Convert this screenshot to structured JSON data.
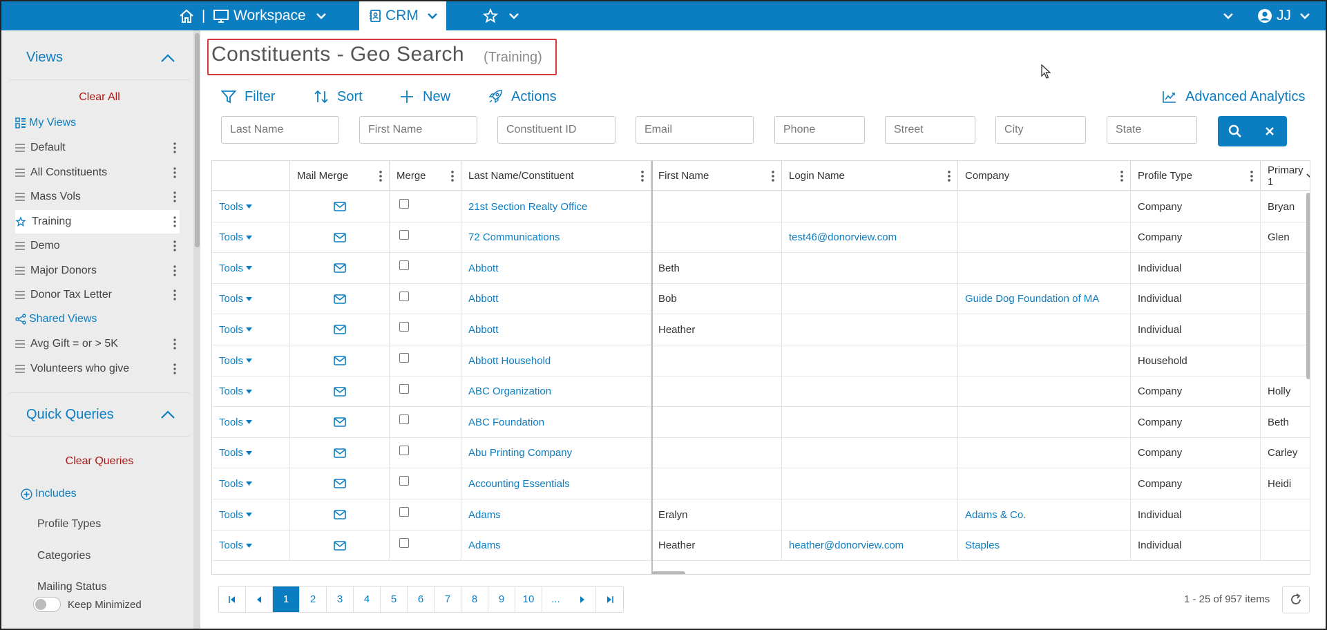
{
  "topbar": {
    "workspace_label": "Workspace",
    "crm_label": "CRM",
    "separator": "|",
    "user_label": "JJ"
  },
  "sidebar": {
    "views_title": "Views",
    "clear_all": "Clear All",
    "my_views": "My Views",
    "my_views_items": [
      {
        "label": "Default"
      },
      {
        "label": "All Constituents"
      },
      {
        "label": "Mass Vols"
      },
      {
        "label": "Training",
        "selected": true
      },
      {
        "label": "Demo"
      },
      {
        "label": "Major Donors"
      },
      {
        "label": "Donor Tax Letter"
      }
    ],
    "shared_views": "Shared Views",
    "shared_views_items": [
      {
        "label": "Avg Gift = or > 5K"
      },
      {
        "label": "Volunteers who give"
      }
    ],
    "quick_queries_title": "Quick Queries",
    "clear_queries": "Clear Queries",
    "includes": "Includes",
    "query_items": [
      "Profile Types",
      "Categories",
      "Mailing Status"
    ],
    "keep_minimized": "Keep Minimized"
  },
  "page": {
    "title": "Constituents - Geo Search",
    "subtitle": "(Training)"
  },
  "toolbar": {
    "filter": "Filter",
    "sort": "Sort",
    "new": "New",
    "actions": "Actions",
    "advanced_analytics": "Advanced Analytics"
  },
  "filters": {
    "last_name": "Last Name",
    "first_name": "First Name",
    "constituent_id": "Constituent ID",
    "email": "Email",
    "phone": "Phone",
    "street": "Street",
    "city": "City",
    "state": "State"
  },
  "grid": {
    "columns": [
      "",
      "Mail Merge",
      "Merge",
      "Last Name/Constituent",
      "First Name",
      "Login Name",
      "Company",
      "Profile Type",
      "Primary 1"
    ],
    "tools_label": "Tools",
    "rows": [
      {
        "last": "21st Section Realty Office",
        "first": "",
        "login": "",
        "company": "",
        "profile": "Company",
        "primary": "Bryan"
      },
      {
        "last": "72 Communications",
        "first": "",
        "login": "test46@donorview.com",
        "company": "",
        "profile": "Company",
        "primary": "Glen"
      },
      {
        "last": "Abbott",
        "first": "Beth",
        "login": "",
        "company": "",
        "profile": "Individual",
        "primary": ""
      },
      {
        "last": "Abbott",
        "first": "Bob",
        "login": "",
        "company": "Guide Dog Foundation of MA",
        "profile": "Individual",
        "primary": ""
      },
      {
        "last": "Abbott",
        "first": "Heather",
        "login": "",
        "company": "",
        "profile": "Individual",
        "primary": ""
      },
      {
        "last": "Abbott Household",
        "first": "",
        "login": "",
        "company": "",
        "profile": "Household",
        "primary": ""
      },
      {
        "last": "ABC Organization",
        "first": "",
        "login": "",
        "company": "",
        "profile": "Company",
        "primary": "Holly"
      },
      {
        "last": "ABC Foundation",
        "first": "",
        "login": "",
        "company": "",
        "profile": "Company",
        "primary": "Beth"
      },
      {
        "last": "Abu Printing Company",
        "first": "",
        "login": "",
        "company": "",
        "profile": "Company",
        "primary": "Carley"
      },
      {
        "last": "Accounting Essentials",
        "first": "",
        "login": "",
        "company": "",
        "profile": "Company",
        "primary": "Heidi"
      },
      {
        "last": "Adams",
        "first": "Eralyn",
        "login": "",
        "company": "Adams & Co.",
        "profile": "Individual",
        "primary": ""
      },
      {
        "last": "Adams",
        "first": "Heather",
        "login": "heather@donorview.com",
        "company": "Staples",
        "profile": "Individual",
        "primary": ""
      }
    ]
  },
  "pager": {
    "pages": [
      "1",
      "2",
      "3",
      "4",
      "5",
      "6",
      "7",
      "8",
      "9",
      "10",
      "..."
    ],
    "current": "1",
    "summary": "1 - 25 of 957 items"
  },
  "colors": {
    "brand": "#0b7dc1",
    "danger": "#b01818",
    "highlight_box": "#d43b3b"
  }
}
